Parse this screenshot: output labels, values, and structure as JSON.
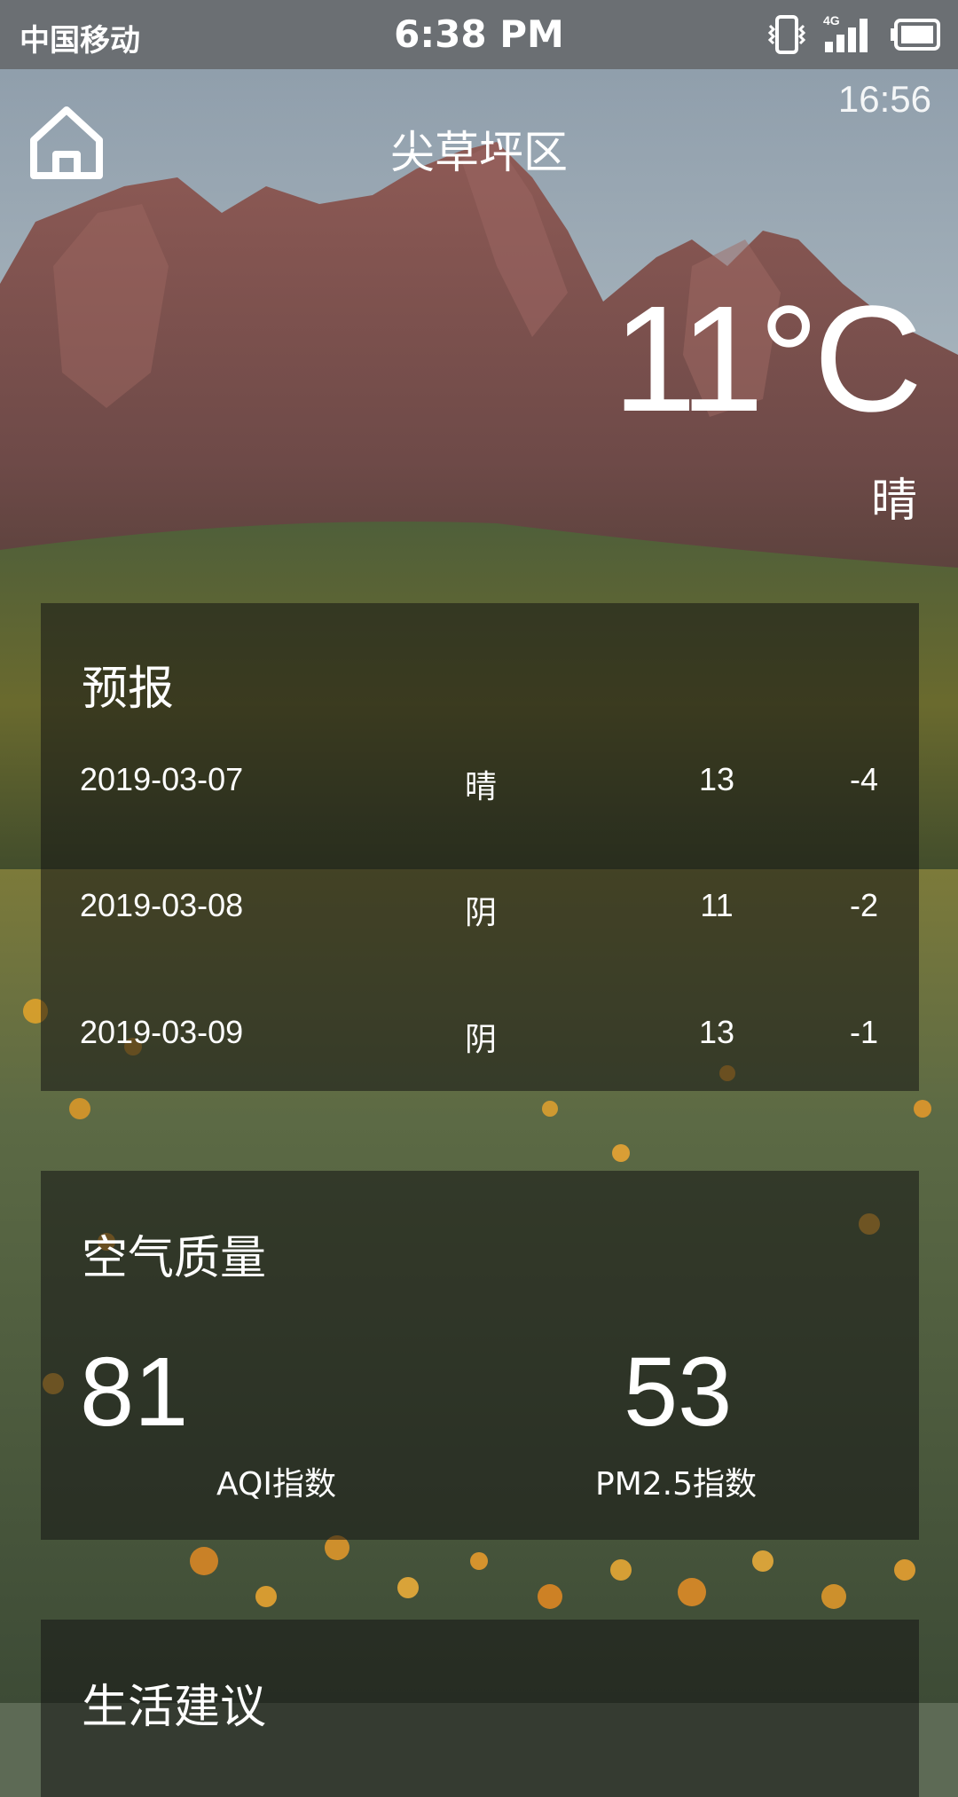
{
  "status_bar": {
    "carrier": "中国移动",
    "time": "6:38 PM",
    "network": "4G"
  },
  "header": {
    "clock": "16:56",
    "title": "尖草坪区"
  },
  "current": {
    "temperature": "11°C",
    "condition": "晴"
  },
  "forecast": {
    "title": "预报",
    "days": [
      {
        "date": "2019-03-07",
        "condition": "晴",
        "high": "13",
        "low": "-4"
      },
      {
        "date": "2019-03-08",
        "condition": "阴",
        "high": "11",
        "low": "-2"
      },
      {
        "date": "2019-03-09",
        "condition": "阴",
        "high": "13",
        "low": "-1"
      }
    ]
  },
  "air_quality": {
    "title": "空气质量",
    "aqi_value": "81",
    "aqi_label": "AQI指数",
    "pm25_value": "53",
    "pm25_label": "PM2.5指数"
  },
  "life_advice": {
    "title": "生活建议"
  },
  "icons": {
    "home": "home-icon",
    "vibrate": "vibrate-icon",
    "signal": "signal-icon",
    "battery": "battery-icon"
  }
}
